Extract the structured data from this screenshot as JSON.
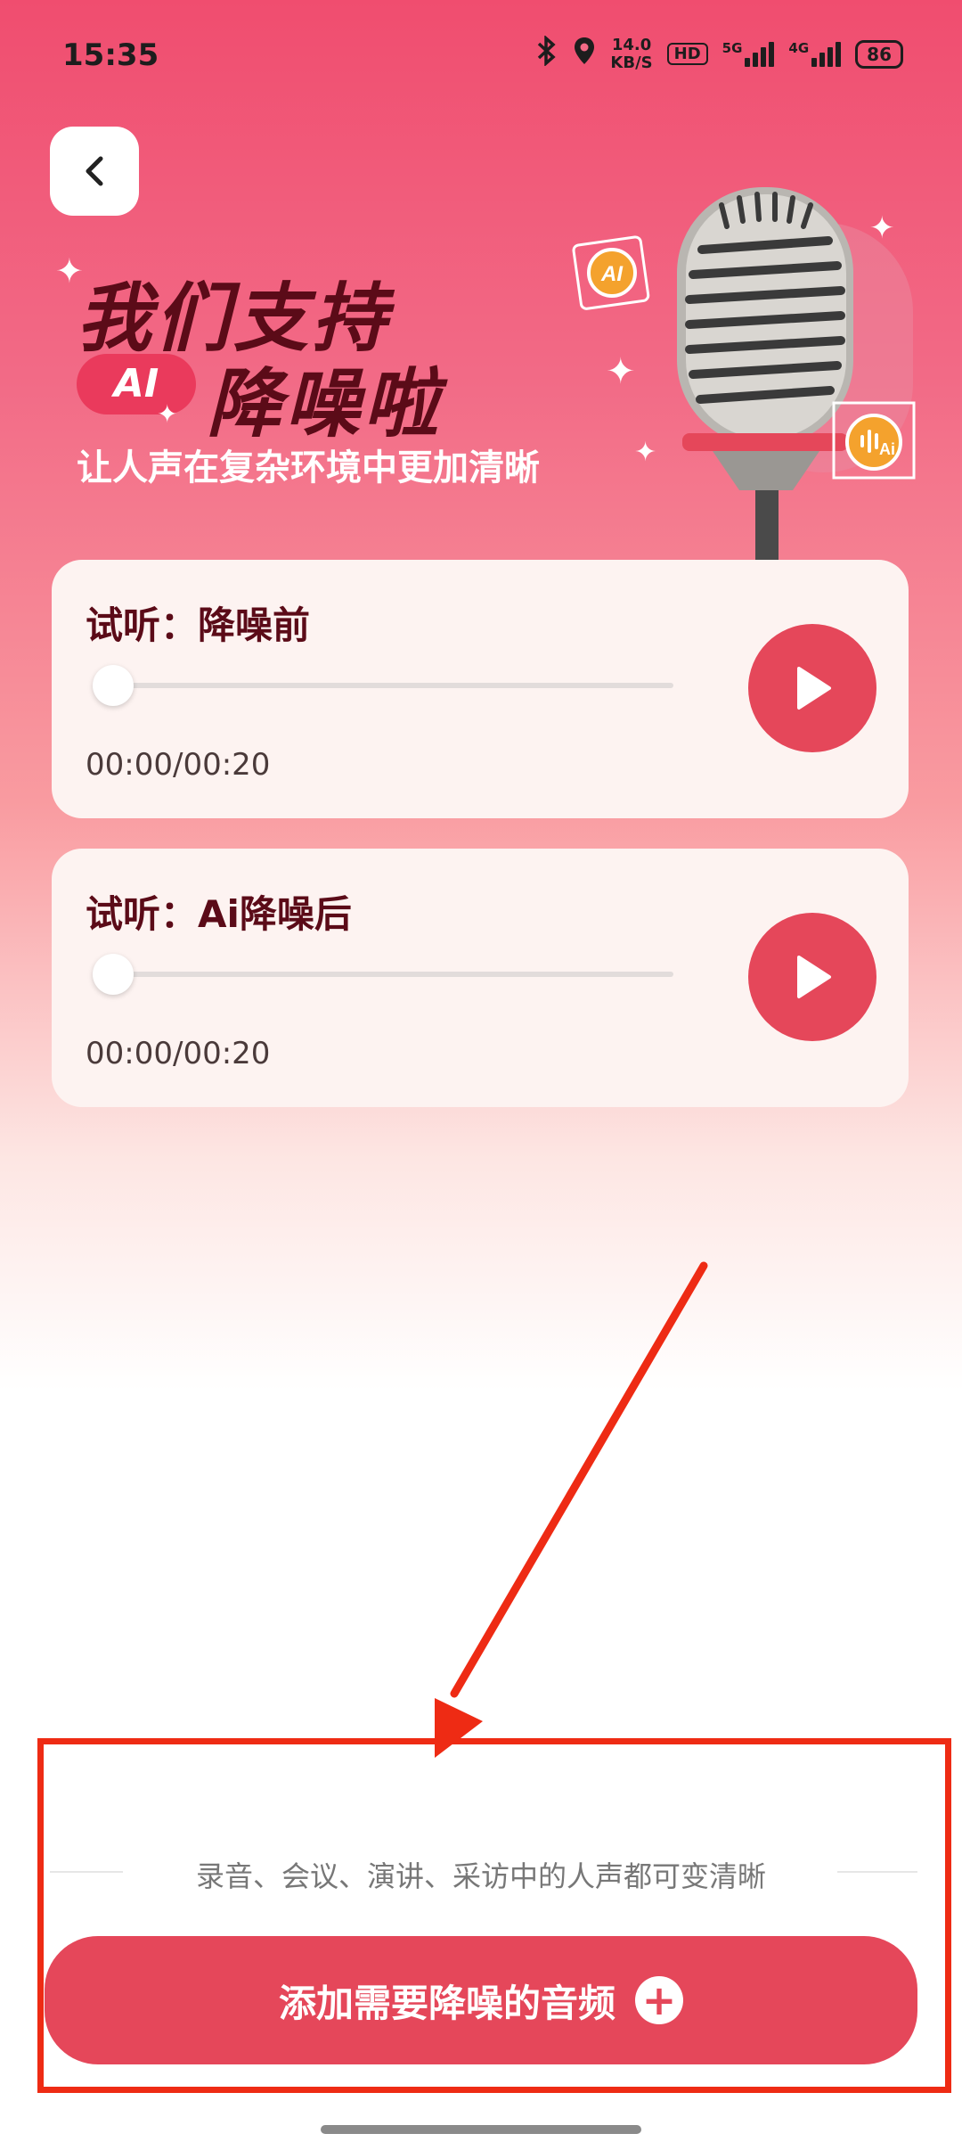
{
  "status_bar": {
    "time": "15:35",
    "net_speed_value": "14.0",
    "net_speed_unit": "KB/S",
    "hd_label": "HD",
    "sig1_label": "5G",
    "sig2_label": "4G",
    "battery": "86"
  },
  "hero": {
    "title_line1": "我们支持",
    "ai_badge": "AI",
    "title_line2": "降噪啦",
    "subtitle": "让人声在复杂环境中更加清晰",
    "mic_badge_1": "AI",
    "mic_badge_2": "Ai"
  },
  "cards": [
    {
      "title": "试听：降噪前",
      "time": "00:00/00:20",
      "progress": 0
    },
    {
      "title": "试听：Ai降噪后",
      "time": "00:00/00:20",
      "progress": 0
    }
  ],
  "bottom": {
    "tip": "录音、会议、演讲、采访中的人声都可变清晰",
    "add_button_label": "添加需要降噪的音频",
    "plus_symbol": "+"
  },
  "colors": {
    "accent": "#e5475a",
    "title_dark": "#5b0b18",
    "annotation_red": "#ee2b14"
  }
}
